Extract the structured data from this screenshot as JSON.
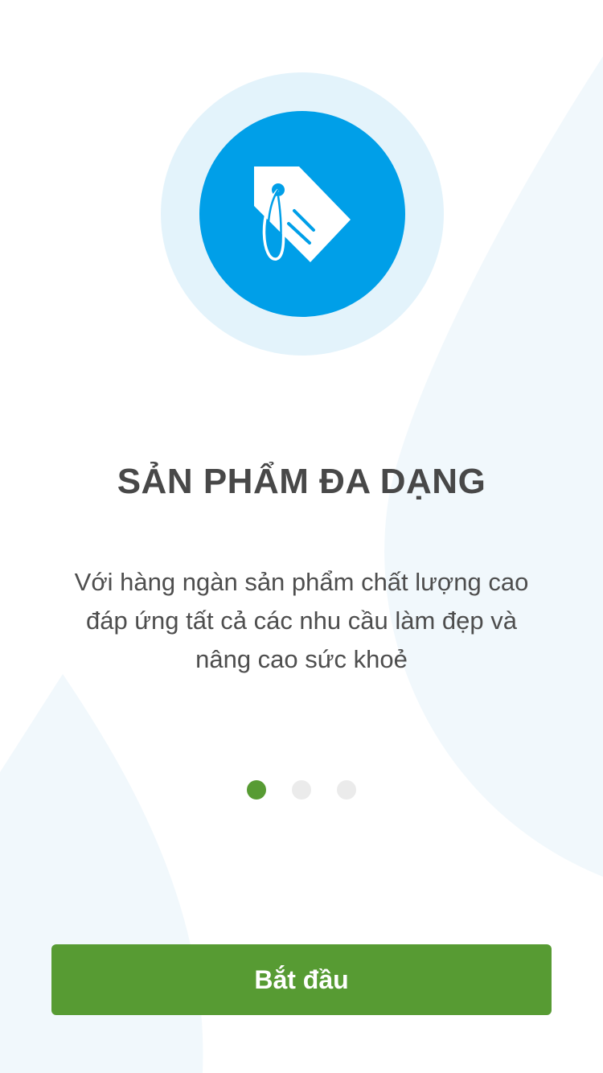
{
  "onboarding": {
    "icon": "price-tag-icon",
    "title": "SẢN PHẨM ĐA DẠNG",
    "description_lines": [
      "Với hàng ngàn sản phẩm chất lượng cao",
      "đáp ứng tất cả các nhu cầu làm đẹp và",
      "nâng cao sức khoẻ"
    ]
  },
  "pager": {
    "total_pages": 3,
    "current_page": 1
  },
  "start_button": {
    "label": "Bắt đầu"
  },
  "colors": {
    "background": "#ffffff",
    "background_shape": "#f1f8fc",
    "icon_halo": "#e3f3fb",
    "icon_circle": "#009fe8",
    "title_text": "#484848",
    "body_text": "#4e4e4e",
    "accent_green": "#579b33",
    "dot_inactive": "#ebebeb"
  }
}
